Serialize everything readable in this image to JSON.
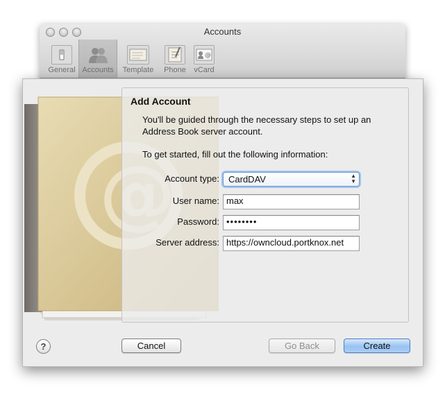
{
  "prefs_window": {
    "title": "Accounts",
    "toolbar": [
      {
        "id": "general",
        "label": "General",
        "icon": "general-switch-icon",
        "selected": false
      },
      {
        "id": "accounts",
        "label": "Accounts",
        "icon": "accounts-people-icon",
        "selected": true
      },
      {
        "id": "template",
        "label": "Template",
        "icon": "template-card-icon",
        "selected": false
      },
      {
        "id": "phone",
        "label": "Phone",
        "icon": "phone-pad-icon",
        "selected": false
      },
      {
        "id": "vcard",
        "label": "vCard",
        "icon": "vcard-icon",
        "selected": false
      }
    ]
  },
  "sheet": {
    "heading": "Add Account",
    "intro": "You'll be guided through the necessary steps to set up an Address Book server account.",
    "instruction": "To get started, fill out the following information:",
    "form": {
      "account_type": {
        "label": "Account type:",
        "value": "CardDAV"
      },
      "user_name": {
        "label": "User name:",
        "value": "max"
      },
      "password": {
        "label": "Password:",
        "value": "••••••••"
      },
      "server_address": {
        "label": "Server address:",
        "value": "https://owncloud.portknox.net"
      }
    },
    "buttons": {
      "help": "?",
      "cancel": "Cancel",
      "go_back": "Go Back",
      "create": "Create"
    }
  },
  "colors": {
    "primary_button": "#98c2f2",
    "focus_ring": "#6ca0e2",
    "book_cover": "#d9c89a"
  }
}
